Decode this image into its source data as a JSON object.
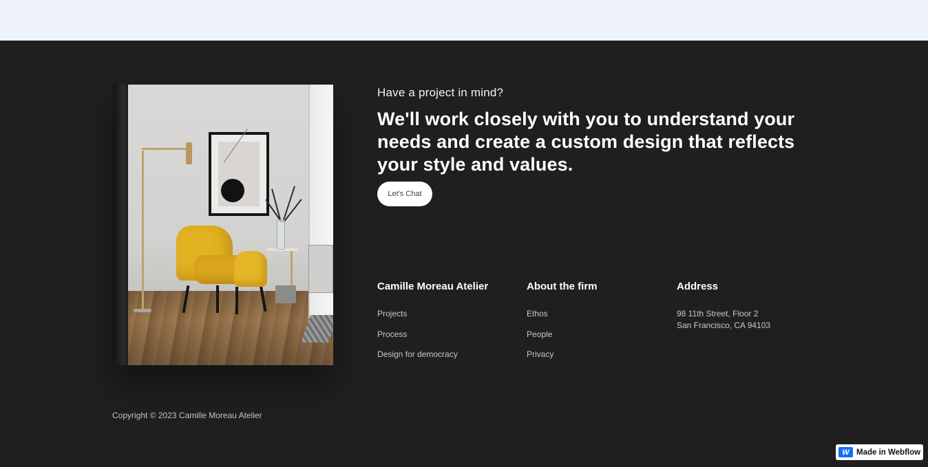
{
  "cta": {
    "eyebrow": "Have a project in mind?",
    "headline": "We'll work closely with you to understand your needs and create a custom design that reflects your style and values.",
    "button_label": "Let's Chat"
  },
  "columns": {
    "brand": {
      "title": "Camille Moreau Atelier",
      "links": [
        "Projects",
        "Process",
        "Design for democracy"
      ]
    },
    "firm": {
      "title": "About the firm",
      "links": [
        "Ethos",
        "People",
        "Privacy"
      ]
    },
    "address": {
      "title": "Address",
      "lines": [
        "98 11th Street, Floor 2",
        "San Francisco, CA 94103"
      ]
    }
  },
  "copyright": "Copyright © 2023 Camille Moreau Atelier",
  "badge": {
    "icon_glyph": "W",
    "label": "Made in Webflow",
    "accent": "#146ef5"
  },
  "colors": {
    "footer_bg": "#1f1f1f",
    "top_band_bg": "#eef2fa",
    "chair": "#e2b222"
  }
}
